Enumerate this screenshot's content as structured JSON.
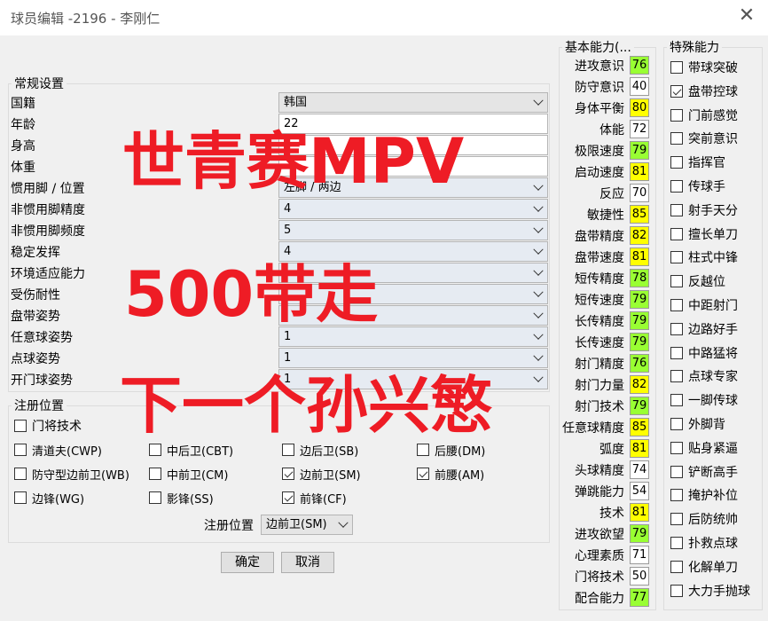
{
  "window": {
    "title": "球员编辑 -2196 - 李刚仁",
    "close_glyph": "✕"
  },
  "general": {
    "legend": "常规设置",
    "fields": [
      {
        "label": "国籍",
        "value": "韩国",
        "kind": "select"
      },
      {
        "label": "年龄",
        "value": "22",
        "kind": "text"
      },
      {
        "label": "身高",
        "value": "",
        "kind": "text"
      },
      {
        "label": "体重",
        "value": "",
        "kind": "text"
      },
      {
        "label": "惯用脚 / 位置",
        "value": "左脚 / 两边",
        "kind": "select-light"
      },
      {
        "label": "非惯用脚精度",
        "value": "4",
        "kind": "select-light"
      },
      {
        "label": "非惯用脚频度",
        "value": "5",
        "kind": "select-light"
      },
      {
        "label": "稳定发挥",
        "value": "4",
        "kind": "select-light"
      },
      {
        "label": "环境适应能力",
        "value": "",
        "kind": "select-light"
      },
      {
        "label": "受伤耐性",
        "value": "",
        "kind": "select-light"
      },
      {
        "label": "盘带姿势",
        "value": "",
        "kind": "select-light"
      },
      {
        "label": "任意球姿势",
        "value": "1",
        "kind": "select-light"
      },
      {
        "label": "点球姿势",
        "value": "1",
        "kind": "select-light"
      },
      {
        "label": "开门球姿势",
        "value": "1",
        "kind": "select-light"
      }
    ]
  },
  "positions": {
    "legend": "注册位置",
    "items": [
      {
        "label": "门将技术",
        "checked": false
      },
      {
        "label": "清道夫(CWP)",
        "checked": false
      },
      {
        "label": "中后卫(CBT)",
        "checked": false
      },
      {
        "label": "边后卫(SB)",
        "checked": false
      },
      {
        "label": "后腰(DM)",
        "checked": false
      },
      {
        "label": "防守型边前卫(WB)",
        "checked": false
      },
      {
        "label": "中前卫(CM)",
        "checked": false
      },
      {
        "label": "边前卫(SM)",
        "checked": true
      },
      {
        "label": "前腰(AM)",
        "checked": true
      },
      {
        "label": "边锋(WG)",
        "checked": false
      },
      {
        "label": "影锋(SS)",
        "checked": false
      },
      {
        "label": "前锋(CF)",
        "checked": true
      }
    ],
    "register_label": "注册位置",
    "register_value": "边前卫(SM)"
  },
  "buttons": {
    "ok": "确定",
    "cancel": "取消"
  },
  "basic": {
    "legend": "基本能力(...",
    "stats": [
      {
        "label": "进攻意识",
        "value": "76",
        "color": "#99ff33"
      },
      {
        "label": "防守意识",
        "value": "40",
        "color": "#ffffff"
      },
      {
        "label": "身体平衡",
        "value": "80",
        "color": "#ffff00"
      },
      {
        "label": "体能",
        "value": "72",
        "color": "#ffffff"
      },
      {
        "label": "极限速度",
        "value": "79",
        "color": "#99ff33"
      },
      {
        "label": "启动速度",
        "value": "81",
        "color": "#ffff00"
      },
      {
        "label": "反应",
        "value": "70",
        "color": "#ffffff"
      },
      {
        "label": "敏捷性",
        "value": "85",
        "color": "#ffff00"
      },
      {
        "label": "盘带精度",
        "value": "82",
        "color": "#ffff00"
      },
      {
        "label": "盘带速度",
        "value": "81",
        "color": "#ffff00"
      },
      {
        "label": "短传精度",
        "value": "78",
        "color": "#99ff33"
      },
      {
        "label": "短传速度",
        "value": "79",
        "color": "#99ff33"
      },
      {
        "label": "长传精度",
        "value": "79",
        "color": "#99ff33"
      },
      {
        "label": "长传速度",
        "value": "79",
        "color": "#99ff33"
      },
      {
        "label": "射门精度",
        "value": "76",
        "color": "#99ff33"
      },
      {
        "label": "射门力量",
        "value": "82",
        "color": "#ffff00"
      },
      {
        "label": "射门技术",
        "value": "79",
        "color": "#99ff33"
      },
      {
        "label": "任意球精度",
        "value": "85",
        "color": "#ffff00"
      },
      {
        "label": "弧度",
        "value": "81",
        "color": "#ffff00"
      },
      {
        "label": "头球精度",
        "value": "74",
        "color": "#ffffff"
      },
      {
        "label": "弹跳能力",
        "value": "54",
        "color": "#ffffff"
      },
      {
        "label": "技术",
        "value": "81",
        "color": "#ffff00"
      },
      {
        "label": "进攻欲望",
        "value": "79",
        "color": "#99ff33"
      },
      {
        "label": "心理素质",
        "value": "71",
        "color": "#ffffff"
      },
      {
        "label": "门将技术",
        "value": "50",
        "color": "#ffffff"
      },
      {
        "label": "配合能力",
        "value": "77",
        "color": "#99ff33"
      }
    ]
  },
  "special": {
    "legend": "特殊能力",
    "items": [
      {
        "label": "带球突破",
        "checked": false
      },
      {
        "label": "盘带控球",
        "checked": true
      },
      {
        "label": "门前感觉",
        "checked": false
      },
      {
        "label": "突前意识",
        "checked": false
      },
      {
        "label": "指挥官",
        "checked": false
      },
      {
        "label": "传球手",
        "checked": false
      },
      {
        "label": "射手天分",
        "checked": false
      },
      {
        "label": "擅长单刀",
        "checked": false
      },
      {
        "label": "柱式中锋",
        "checked": false
      },
      {
        "label": "反越位",
        "checked": false
      },
      {
        "label": "中距射门",
        "checked": false
      },
      {
        "label": "边路好手",
        "checked": false
      },
      {
        "label": "中路猛将",
        "checked": false
      },
      {
        "label": "点球专家",
        "checked": false
      },
      {
        "label": "一脚传球",
        "checked": false
      },
      {
        "label": "外脚背",
        "checked": false
      },
      {
        "label": "贴身紧逼",
        "checked": false
      },
      {
        "label": "铲断高手",
        "checked": false
      },
      {
        "label": "掩护补位",
        "checked": false
      },
      {
        "label": "后防统帅",
        "checked": false
      },
      {
        "label": "扑救点球",
        "checked": false
      },
      {
        "label": "化解单刀",
        "checked": false
      },
      {
        "label": "大力手抛球",
        "checked": false
      }
    ]
  },
  "overlay": {
    "line1": "世青赛MPV",
    "line2": "500带走",
    "line3": "下一个孙兴慜",
    "color": "#ee1c25"
  }
}
